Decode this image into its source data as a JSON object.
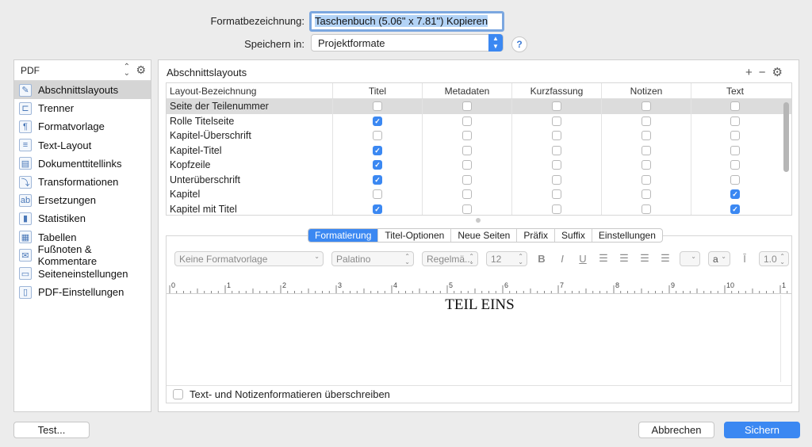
{
  "form": {
    "name_label": "Formatbezeichnung:",
    "name_value": "Taschenbuch (5.06\" x 7.81\") Kopieren",
    "save_label": "Speichern in:",
    "save_value": "Projektformate",
    "help": "?"
  },
  "sidebar": {
    "header": "PDF",
    "items": [
      {
        "label": "Abschnittslayouts",
        "icon": "brush-icon",
        "glyph": "✎"
      },
      {
        "label": "Trenner",
        "icon": "separator-icon",
        "glyph": "⊏"
      },
      {
        "label": "Formatvorlage",
        "icon": "style-icon",
        "glyph": "¶"
      },
      {
        "label": "Text-Layout",
        "icon": "text-layout-icon",
        "glyph": "≡"
      },
      {
        "label": "Dokumenttitellinks",
        "icon": "document-icon",
        "glyph": "▤"
      },
      {
        "label": "Transformationen",
        "icon": "transform-icon",
        "glyph": "⤵"
      },
      {
        "label": "Ersetzungen",
        "icon": "replace-icon",
        "glyph": "ab"
      },
      {
        "label": "Statistiken",
        "icon": "stats-icon",
        "glyph": "▮"
      },
      {
        "label": "Tabellen",
        "icon": "table-icon",
        "glyph": "▦"
      },
      {
        "label": "Fußnoten & Kommentare",
        "icon": "footnote-icon",
        "glyph": "✉"
      },
      {
        "label": "Seiteneinstellungen",
        "icon": "page-settings-icon",
        "glyph": "▭"
      },
      {
        "label": "PDF-Einstellungen",
        "icon": "pdf-icon",
        "glyph": "▯"
      }
    ]
  },
  "panel": {
    "title": "Abschnittslayouts",
    "tools": "+ − ⚙",
    "columns": [
      "Layout-Bezeichnung",
      "Titel",
      "Metadaten",
      "Kurzfassung",
      "Notizen",
      "Text"
    ],
    "rows": [
      {
        "name": "Seite der Teilenummer",
        "checks": [
          false,
          false,
          false,
          false,
          false
        ],
        "selected": true
      },
      {
        "name": "Rolle Titelseite",
        "checks": [
          true,
          false,
          false,
          false,
          false
        ]
      },
      {
        "name": "Kapitel-Überschrift",
        "checks": [
          false,
          false,
          false,
          false,
          false
        ]
      },
      {
        "name": "Kapitel-Titel",
        "checks": [
          true,
          false,
          false,
          false,
          false
        ]
      },
      {
        "name": "Kopfzeile",
        "checks": [
          true,
          false,
          false,
          false,
          false
        ]
      },
      {
        "name": "Unterüberschrift",
        "checks": [
          true,
          false,
          false,
          false,
          false
        ]
      },
      {
        "name": "Kapitel",
        "checks": [
          false,
          false,
          false,
          false,
          true
        ]
      },
      {
        "name": "Kapitel mit Titel",
        "checks": [
          true,
          false,
          false,
          false,
          true
        ]
      }
    ],
    "tabs": [
      "Formatierung",
      "Titel-Optionen",
      "Neue Seiten",
      "Präfix",
      "Suffix",
      "Einstellungen"
    ],
    "active_tab": 0
  },
  "toolbar": {
    "style": "Keine Formatvorlage",
    "font": "Palatino",
    "weight": "Regelmä...",
    "size": "12",
    "bold": "B",
    "italic": "I",
    "underline": "U",
    "color": "a",
    "spacing": "1.0"
  },
  "ruler": [
    "0",
    "1",
    "2",
    "3",
    "4",
    "5",
    "6",
    "7",
    "8",
    "9",
    "10",
    "1"
  ],
  "editor": {
    "preview_text": "TEIL EINS",
    "override_label": "Text- und Notizenformatieren überschreiben"
  },
  "buttons": {
    "test": "Test...",
    "cancel": "Abbrechen",
    "save": "Sichern"
  },
  "colors": {
    "accent": "#3b88f2"
  }
}
